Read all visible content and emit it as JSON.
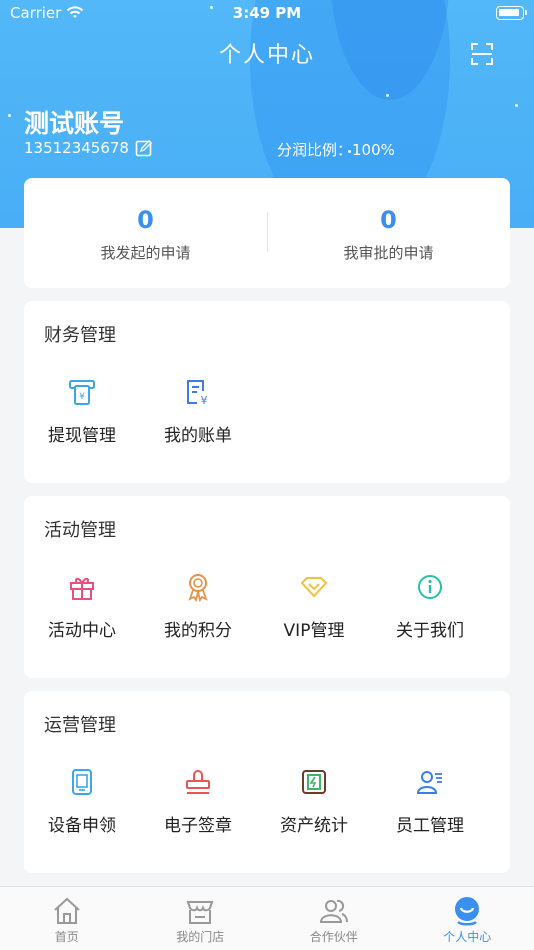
{
  "status_bar": {
    "carrier": "Carrier",
    "time": "3:49 PM"
  },
  "header": {
    "title": "个人中心"
  },
  "user": {
    "name": "测试账号",
    "phone": "13512345678",
    "profit_ratio": "分润比例：100%"
  },
  "stats": [
    {
      "value": "0",
      "label": "我发起的申请"
    },
    {
      "value": "0",
      "label": "我审批的申请"
    }
  ],
  "sections": {
    "finance": {
      "title": "财务管理",
      "items": [
        {
          "label": "提现管理"
        },
        {
          "label": "我的账单"
        }
      ]
    },
    "activity": {
      "title": "活动管理",
      "items": [
        {
          "label": "活动中心"
        },
        {
          "label": "我的积分"
        },
        {
          "label": "VIP管理"
        },
        {
          "label": "关于我们"
        }
      ]
    },
    "operation": {
      "title": "运营管理",
      "items": [
        {
          "label": "设备申领"
        },
        {
          "label": "电子签章"
        },
        {
          "label": "资产统计"
        },
        {
          "label": "员工管理"
        }
      ]
    }
  },
  "tabbar": [
    {
      "label": "首页",
      "icon": "home-icon"
    },
    {
      "label": "我的门店",
      "icon": "store-icon"
    },
    {
      "label": "合作伙伴",
      "icon": "partners-icon"
    },
    {
      "label": "个人中心",
      "icon": "profile-icon",
      "active": true
    }
  ],
  "colors": {
    "header": "#49aef5",
    "accent": "#3b8fee"
  }
}
